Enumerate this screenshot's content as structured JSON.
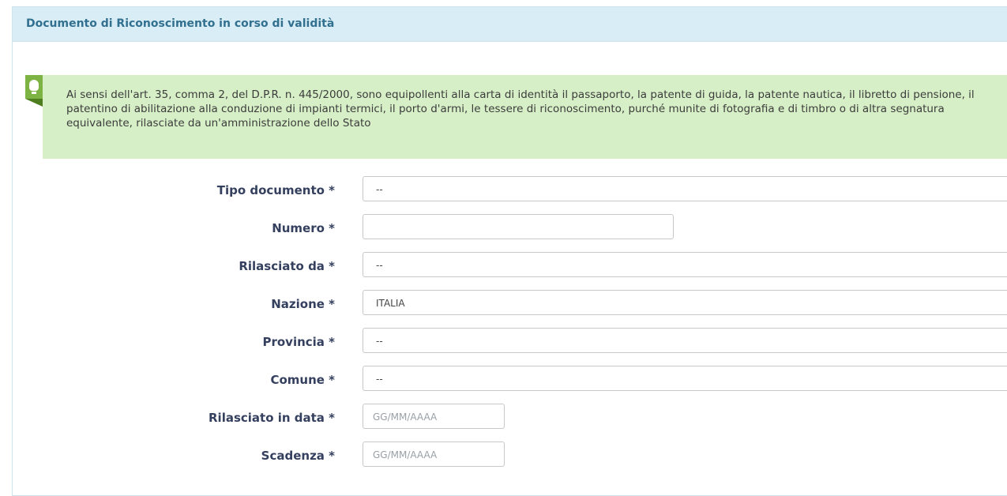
{
  "panel": {
    "title": "Documento di Riconoscimento in corso di validità"
  },
  "alert": {
    "icon": "lightbulb-icon",
    "text": "Ai sensi dell'art. 35, comma 2, del D.P.R. n. 445/2000, sono equipollenti alla carta di identità il passaporto, la patente di guida, la patente nautica, il libretto di pensione, il patentino di abilitazione alla conduzione di impianti termici, il porto d'armi, le tessere di riconoscimento, purché munite di fotografia e di timbro o di altra segnatura equivalente, rilasciate da un'amministrazione dello Stato"
  },
  "form": {
    "tipo_documento": {
      "label": "Tipo documento *",
      "value": "--"
    },
    "numero": {
      "label": "Numero *",
      "value": ""
    },
    "rilasciato_da": {
      "label": "Rilasciato da *",
      "value": "--"
    },
    "nazione": {
      "label": "Nazione *",
      "value": "ITALIA"
    },
    "provincia": {
      "label": "Provincia *",
      "value": "--"
    },
    "comune": {
      "label": "Comune *",
      "value": "--"
    },
    "rilasciato_in_data": {
      "label": "Rilasciato in data *",
      "placeholder": "GG/MM/AAAA"
    },
    "scadenza": {
      "label": "Scadenza *",
      "placeholder": "GG/MM/AAAA"
    }
  },
  "colors": {
    "header_bg": "#d9edf7",
    "header_text": "#31708f",
    "alert_bg": "#d6efc6",
    "badge": "#7cb342",
    "label_text": "#34405e"
  }
}
